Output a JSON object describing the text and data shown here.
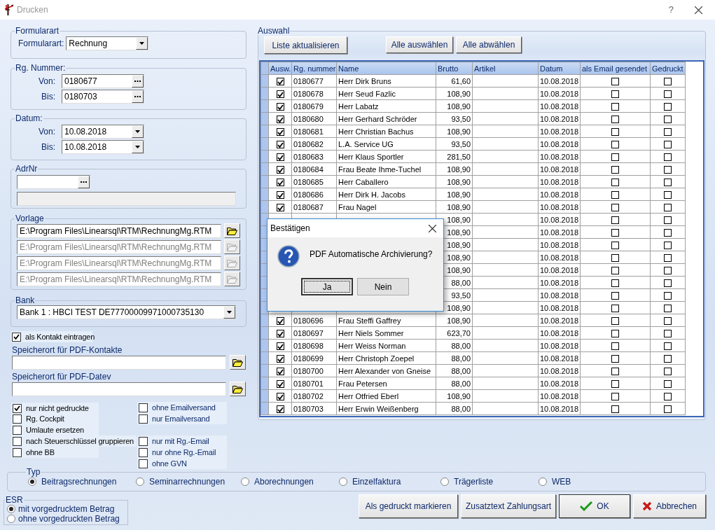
{
  "window": {
    "title": "Drucken",
    "help": "?"
  },
  "formularart": {
    "title": "Formularart",
    "label": "Formularart:",
    "value": "Rechnung"
  },
  "rg_nummer": {
    "title": "Rg. Nummer:",
    "fields": [
      {
        "label": "Von:",
        "value": "0180677"
      },
      {
        "label": "Bis:",
        "value": "0180703"
      }
    ]
  },
  "datum": {
    "title": "Datum:",
    "fields": [
      {
        "label": "Von:",
        "value": "10.08.2018"
      },
      {
        "label": "Bis:",
        "value": "10.08.2018"
      }
    ]
  },
  "adrnr": {
    "title": "AdrNr"
  },
  "vorlage": {
    "title": "Vorlage",
    "files": [
      {
        "value": "E:\\Program Files\\Linearsql\\RTM\\RechnungMg.RTM",
        "disabled": false
      },
      {
        "value": "E:\\Program Files\\Linearsql\\RTM\\RechnungMg.RTM",
        "disabled": true
      },
      {
        "value": "E:\\Program Files\\Linearsql\\RTM\\RechnungMg.RTM",
        "disabled": true
      },
      {
        "value": "E:\\Program Files\\Linearsql\\RTM\\RechnungMg.RTM",
        "disabled": true
      }
    ]
  },
  "bank": {
    "title": "Bank",
    "value": "Bank 1 : HBCI TEST DE77700009971000735130"
  },
  "kontakt": {
    "label": "als Kontakt eintragen",
    "checked": true
  },
  "pdf_paths": [
    {
      "label": "Speicherort für PDF-Kontakte"
    },
    {
      "label": "Speicherort für PDF-Datev"
    }
  ],
  "options_left": [
    {
      "label": "nur nicht gedruckte",
      "checked": true
    },
    {
      "label": "Rg. Cockpit",
      "checked": false
    },
    {
      "label": "Umlaute ersetzen",
      "checked": false
    },
    {
      "label": "nach Steuerschlüssel gruppieren",
      "checked": false
    },
    {
      "label": "ohne BB",
      "checked": false
    }
  ],
  "options_right": [
    [
      {
        "label": "ohne Emailversand",
        "checked": false
      },
      {
        "label": "nur Emailversand",
        "checked": false
      }
    ],
    [
      {
        "label": "nur mit Rg.-Email",
        "checked": false
      },
      {
        "label": "nur ohne Rg.-Email",
        "checked": false
      },
      {
        "label": "ohne GVN",
        "checked": false
      }
    ]
  ],
  "auswahl": {
    "title": "Auswahl",
    "buttons": [
      "Liste aktualisieren",
      "Alle auswählen",
      "Alle abwählen"
    ]
  },
  "table": {
    "columns": [
      "Ausw.",
      "Rg. nummer",
      "Name",
      "Brutto",
      "Artikel",
      "Datum",
      "als Email gesendet",
      "Gedruckt"
    ],
    "rows": [
      {
        "ausw": true,
        "nr": "0180677",
        "name": "Herr Dirk Bruns",
        "brutto": "61,60",
        "datum": "10.08.2018",
        "email": false,
        "gedruckt": false
      },
      {
        "ausw": true,
        "nr": "0180678",
        "name": "Herr Seud Fazlic",
        "brutto": "108,90",
        "datum": "10.08.2018",
        "email": false,
        "gedruckt": false
      },
      {
        "ausw": true,
        "nr": "0180679",
        "name": "Herr  Labatz",
        "brutto": "108,90",
        "datum": "10.08.2018",
        "email": false,
        "gedruckt": false
      },
      {
        "ausw": true,
        "nr": "0180680",
        "name": "Herr Gerhard Schröder",
        "brutto": "93,50",
        "datum": "10.08.2018",
        "email": false,
        "gedruckt": false
      },
      {
        "ausw": true,
        "nr": "0180681",
        "name": "Herr Christian Bachus",
        "brutto": "108,90",
        "datum": "10.08.2018",
        "email": false,
        "gedruckt": false
      },
      {
        "ausw": true,
        "nr": "0180682",
        "name": "L.A. Service UG",
        "brutto": "93,50",
        "datum": "10.08.2018",
        "email": false,
        "gedruckt": false
      },
      {
        "ausw": true,
        "nr": "0180683",
        "name": "Herr Klaus Sportler",
        "brutto": "281,50",
        "datum": "10.08.2018",
        "email": false,
        "gedruckt": false
      },
      {
        "ausw": true,
        "nr": "0180684",
        "name": "Frau Beate Ihme-Tuchel",
        "brutto": "108,90",
        "datum": "10.08.2018",
        "email": false,
        "gedruckt": false
      },
      {
        "ausw": true,
        "nr": "0180685",
        "name": "Herr  Caballero",
        "brutto": "108,90",
        "datum": "10.08.2018",
        "email": false,
        "gedruckt": false
      },
      {
        "ausw": true,
        "nr": "0180686",
        "name": "Herr Dirk H. Jacobs",
        "brutto": "108,90",
        "datum": "10.08.2018",
        "email": false,
        "gedruckt": false
      },
      {
        "ausw": true,
        "nr": "0180687",
        "name": "Frau  Nagel",
        "brutto": "108,90",
        "datum": "10.08.2018",
        "email": false,
        "gedruckt": false
      },
      {
        "brutto": "108,90",
        "datum": "10.08.2018",
        "email": false,
        "gedruckt": false
      },
      {
        "brutto": "108,90",
        "datum": "10.08.2018",
        "email": false,
        "gedruckt": false
      },
      {
        "brutto": "108,90",
        "datum": "10.08.2018",
        "email": false,
        "gedruckt": false
      },
      {
        "brutto": "108,90",
        "datum": "10.08.2018",
        "email": false,
        "gedruckt": false
      },
      {
        "brutto": "108,90",
        "datum": "10.08.2018",
        "email": false,
        "gedruckt": false
      },
      {
        "brutto": "88,00",
        "datum": "10.08.2018",
        "email": false,
        "gedruckt": false
      },
      {
        "brutto": "93,50",
        "datum": "10.08.2018",
        "email": false,
        "gedruckt": false
      },
      {
        "brutto": "108,90",
        "datum": "10.08.2018",
        "email": false,
        "gedruckt": false
      },
      {
        "ausw": true,
        "nr": "0180696",
        "name": "Frau Steffi Gaffrey",
        "brutto": "108,90",
        "datum": "10.08.2018",
        "email": false,
        "gedruckt": false
      },
      {
        "ausw": true,
        "nr": "0180697",
        "name": "Herr Niels Sommer",
        "brutto": "623,70",
        "datum": "10.08.2018",
        "email": false,
        "gedruckt": false
      },
      {
        "ausw": true,
        "nr": "0180698",
        "name": "Herr Weiss Norman",
        "brutto": "88,00",
        "datum": "10.08.2018",
        "email": false,
        "gedruckt": false
      },
      {
        "ausw": true,
        "nr": "0180699",
        "name": "Herr Christoph Zoepel",
        "brutto": "88,00",
        "datum": "10.08.2018",
        "email": false,
        "gedruckt": false
      },
      {
        "ausw": true,
        "nr": "0180700",
        "name": "Herr Alexander von Gneise",
        "brutto": "88,00",
        "datum": "10.08.2018",
        "email": false,
        "gedruckt": false
      },
      {
        "ausw": true,
        "nr": "0180701",
        "name": "Frau  Petersen",
        "brutto": "88,00",
        "datum": "10.08.2018",
        "email": false,
        "gedruckt": false
      },
      {
        "ausw": true,
        "nr": "0180702",
        "name": "Herr Otfried Eberl",
        "brutto": "108,90",
        "datum": "10.08.2018",
        "email": false,
        "gedruckt": false
      },
      {
        "ausw": true,
        "nr": "0180703",
        "name": "Herr Erwin Weißenberg",
        "brutto": "88,00",
        "datum": "10.08.2018",
        "email": false,
        "gedruckt": false
      }
    ]
  },
  "typ": {
    "title": "Typ",
    "options": [
      {
        "label": "Beitragsrechnungen",
        "selected": true
      },
      {
        "label": "Seminarrechnungen",
        "selected": false
      },
      {
        "label": "Aborechnungen",
        "selected": false
      },
      {
        "label": "Einzelfaktura",
        "selected": false
      },
      {
        "label": "Trägerliste",
        "selected": false
      },
      {
        "label": "WEB",
        "selected": false
      }
    ]
  },
  "esr": {
    "title": "ESR",
    "options": [
      {
        "label": "mit vorgedrucktem Betrag",
        "selected": true
      },
      {
        "label": "ohne vorgedruckten Betrag",
        "selected": false
      }
    ]
  },
  "buttons": [
    {
      "label": "Als gedruckt markieren",
      "kind": "plain"
    },
    {
      "label": "Zusatztext Zahlungsart",
      "kind": "plain"
    },
    {
      "label": "OK",
      "kind": "ok"
    },
    {
      "label": "Abbrechen",
      "kind": "cancel"
    }
  ],
  "dialog": {
    "title": "Bestätigen",
    "message": "PDF Automatische Archivierung?",
    "buttons": [
      {
        "label": "Ja",
        "focused": true
      },
      {
        "label": "Nein",
        "focused": false
      }
    ]
  }
}
